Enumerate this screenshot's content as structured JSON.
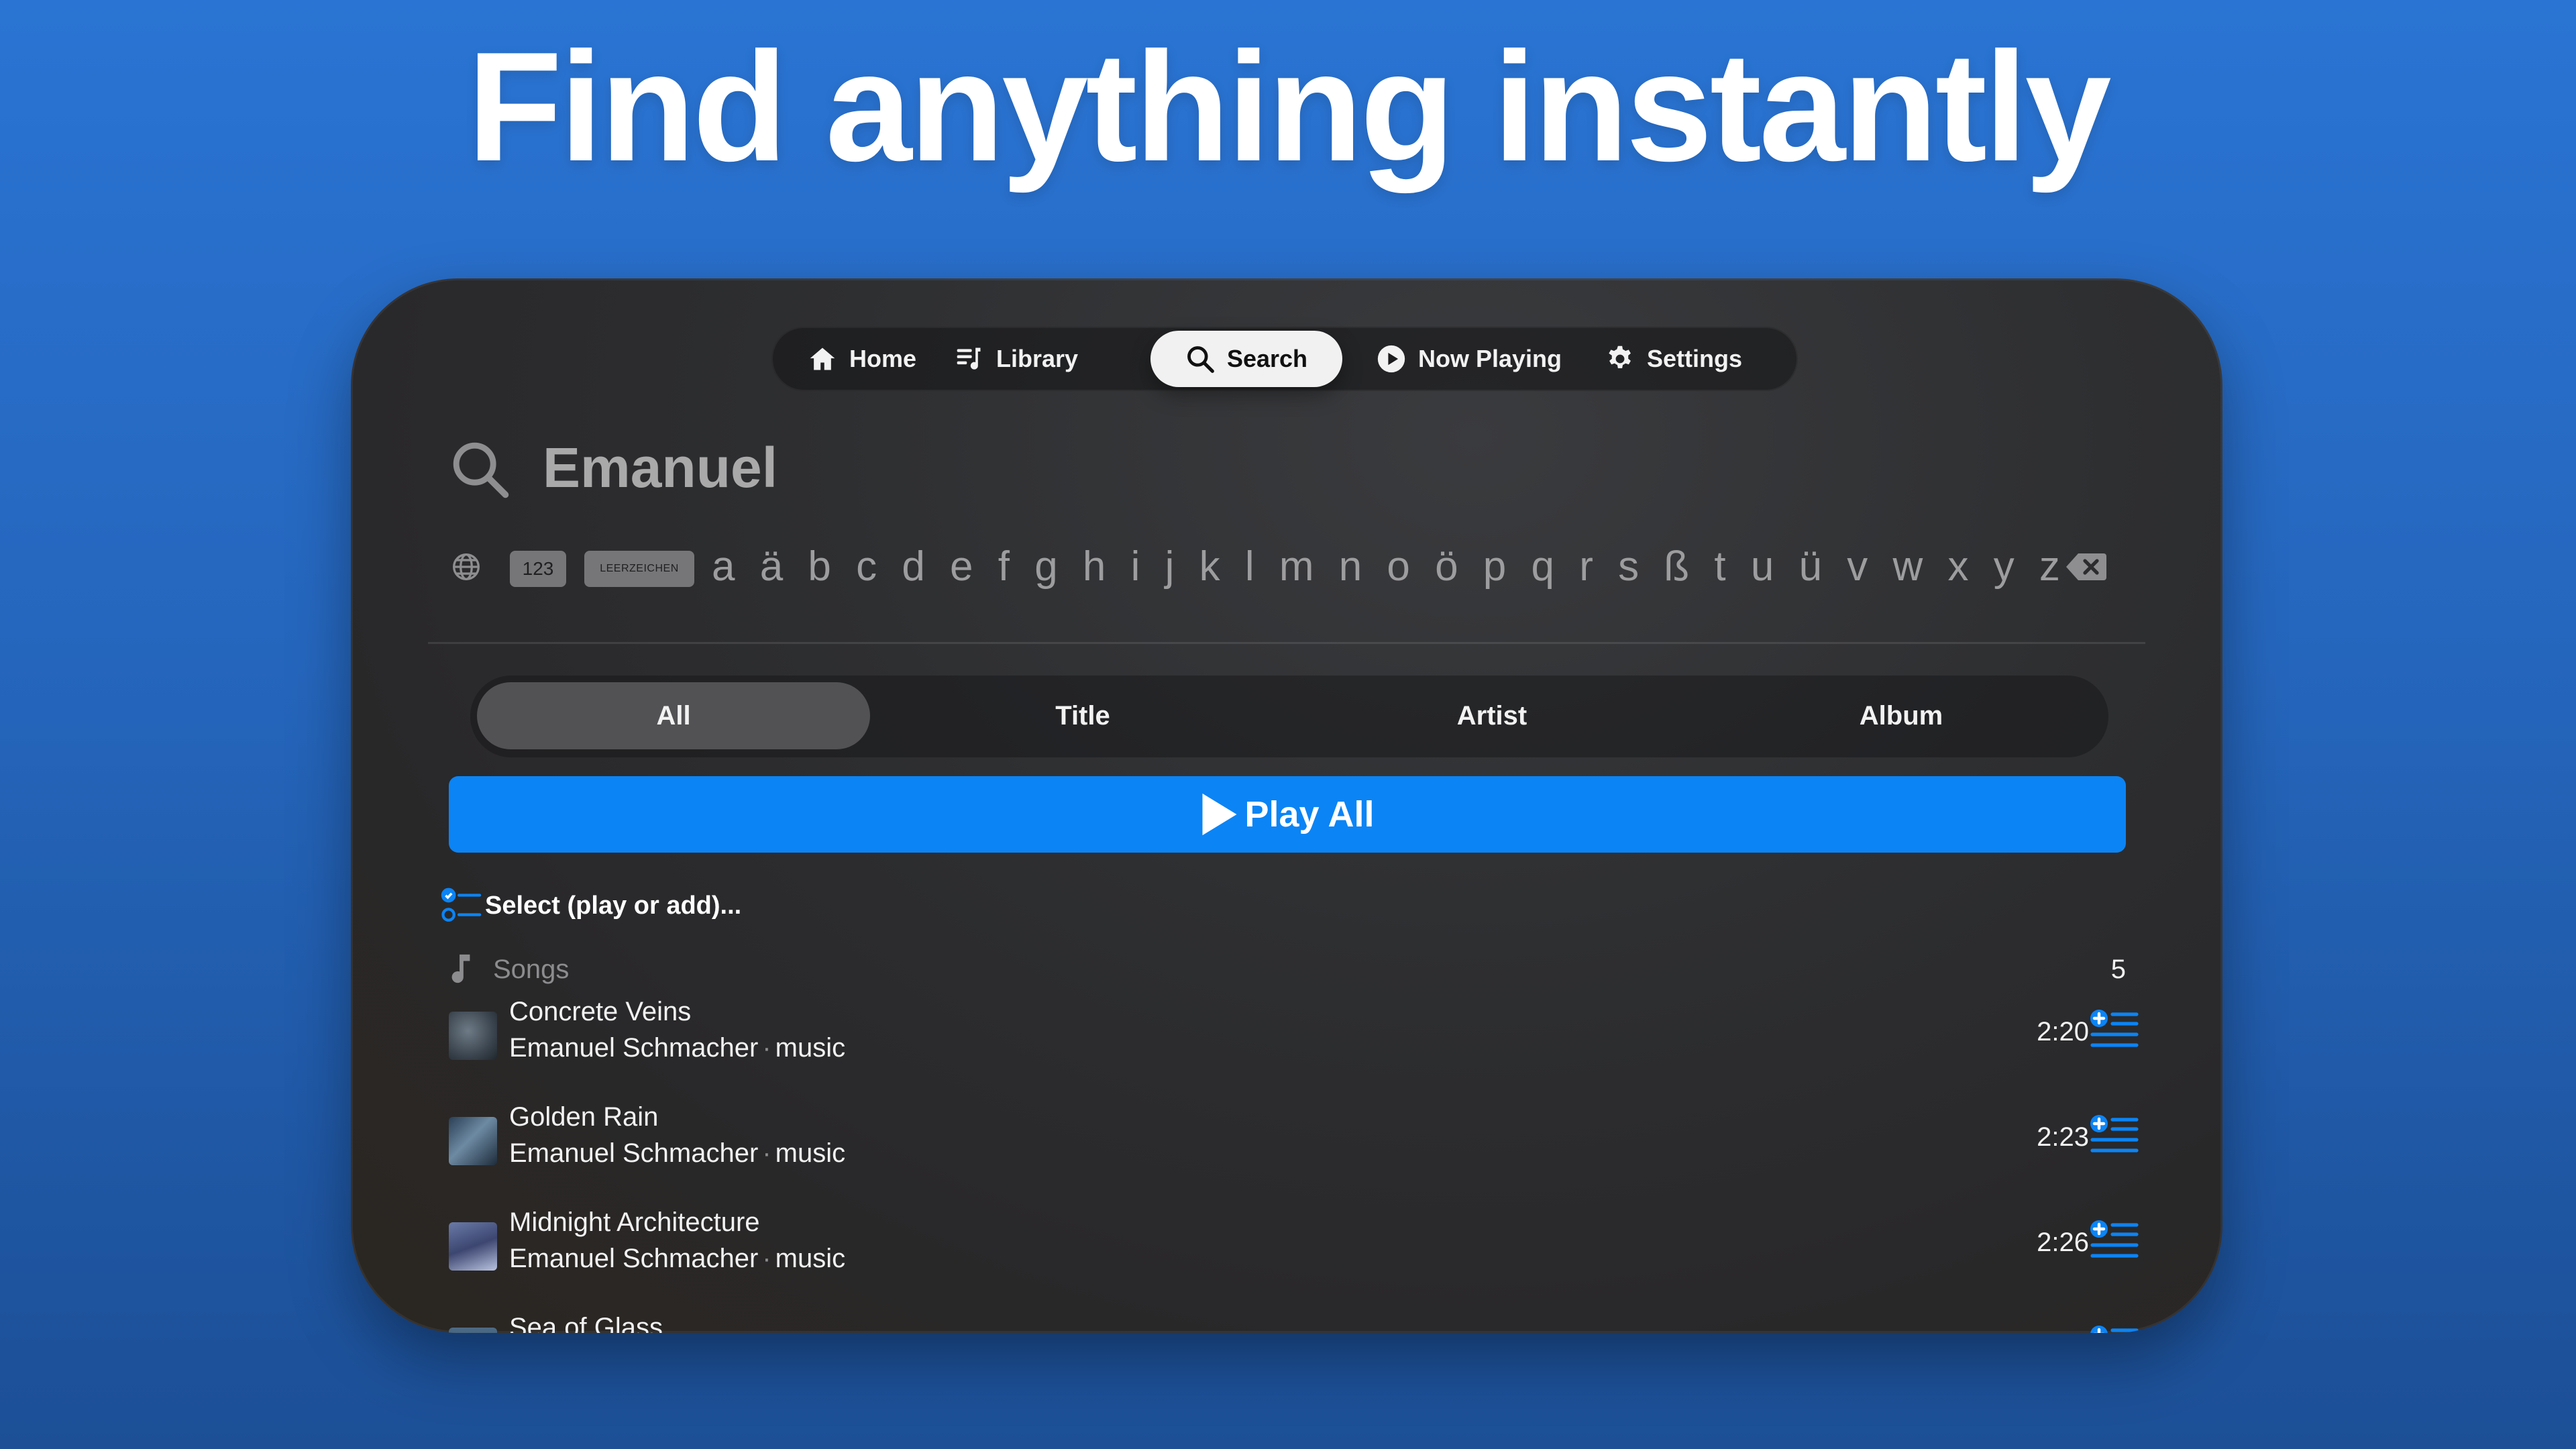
{
  "headline": "Find anything instantly",
  "tabs": [
    {
      "label": "Home",
      "icon": "house-icon"
    },
    {
      "label": "Library",
      "icon": "music-list-icon"
    },
    {
      "label": "Search",
      "icon": "magnifier-icon",
      "active": true
    },
    {
      "label": "Now Playing",
      "icon": "play-circle-icon"
    },
    {
      "label": "Settings",
      "icon": "gear-icon"
    }
  ],
  "search": {
    "query": "Emanuel"
  },
  "keyboard": {
    "numbers_key": "123",
    "space_key": "LEERZEICHEN",
    "letters": [
      "a",
      "ä",
      "b",
      "c",
      "d",
      "e",
      "f",
      "g",
      "h",
      "i",
      "j",
      "k",
      "l",
      "m",
      "n",
      "o",
      "ö",
      "p",
      "q",
      "r",
      "s",
      "ß",
      "t",
      "u",
      "ü",
      "v",
      "w",
      "x",
      "y",
      "z"
    ]
  },
  "filters": [
    {
      "label": "All",
      "active": true
    },
    {
      "label": "Title"
    },
    {
      "label": "Artist"
    },
    {
      "label": "Album"
    }
  ],
  "play_all_label": "Play All",
  "select_label": "Select (play or add)...",
  "songs_section": {
    "label": "Songs",
    "count": "5"
  },
  "songs": [
    {
      "title": "Concrete Veins",
      "artist": "Emanuel Schmacher",
      "album": "music",
      "duration": "2:20"
    },
    {
      "title": "Golden Rain",
      "artist": "Emanuel Schmacher",
      "album": "music",
      "duration": "2:23"
    },
    {
      "title": "Midnight Architecture",
      "artist": "Emanuel Schmacher",
      "album": "music",
      "duration": "2:26"
    },
    {
      "title": "Sea of Glass",
      "artist": "",
      "album": "",
      "duration": ""
    }
  ],
  "separator": "·",
  "colors": {
    "accent": "#0b84f5",
    "background_top": "#2a74d3",
    "background_bottom": "#1c4f96",
    "panel": "#2e2f31"
  }
}
